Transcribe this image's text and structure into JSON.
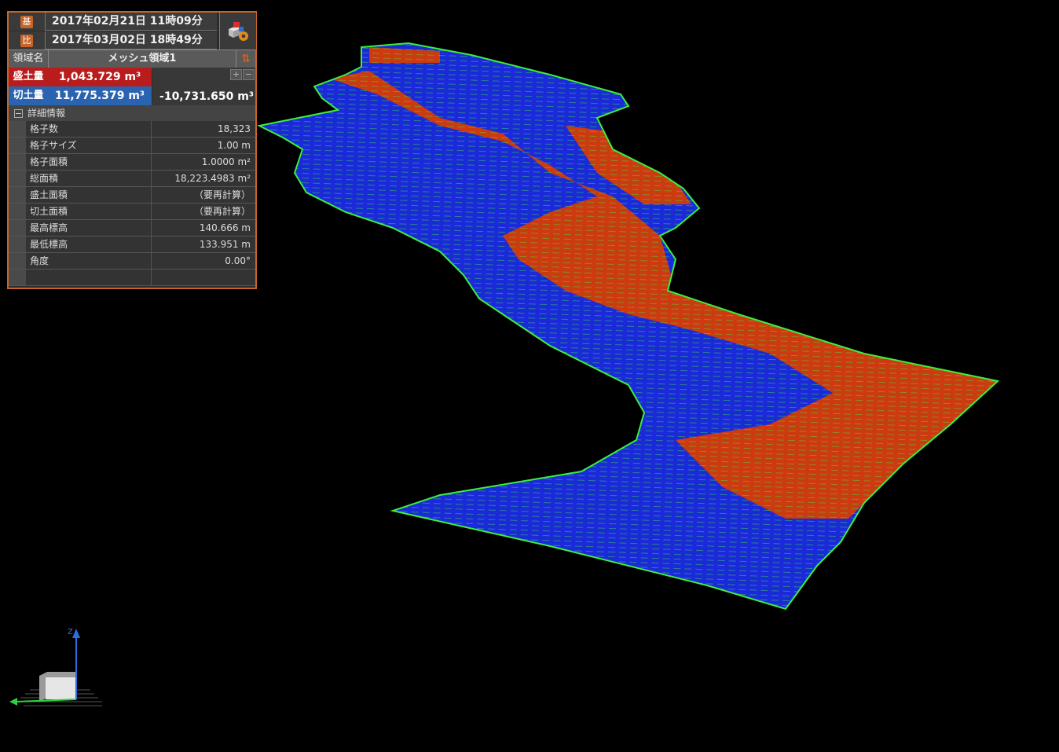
{
  "header": {
    "base_tag": "基",
    "base_date": "2017年02月21日 11時09分",
    "compare_tag": "比",
    "compare_date": "2017年03月02日 18時49分",
    "region_label": "領域名",
    "region_name": "メッシュ領域1",
    "sort_icon": "⇅"
  },
  "volumes": {
    "fill_label": "盛土量",
    "fill_value": "1,043.729 m³",
    "cut_label": "切土量",
    "cut_value": "11,775.379 m³",
    "net_value": "-10,731.650 m³",
    "plus": "+",
    "minus": "−"
  },
  "details": {
    "title": "詳細情報",
    "rows": [
      {
        "label": "格子数",
        "value": "18,323"
      },
      {
        "label": "格子サイズ",
        "value": "1.00 m"
      },
      {
        "label": "格子面積",
        "value": "1.0000 m²"
      },
      {
        "label": "総面積",
        "value": "18,223.4983 m²"
      },
      {
        "label": "盛土面積",
        "value": "（要再計算）"
      },
      {
        "label": "切土面積",
        "value": "（要再計算）"
      },
      {
        "label": "最高標高",
        "value": "140.666 m"
      },
      {
        "label": "最低標高",
        "value": "133.951 m"
      },
      {
        "label": "角度",
        "value": "0.00°"
      },
      {
        "label": "",
        "value": ""
      }
    ]
  },
  "axis": {
    "z_label": "Z"
  },
  "colors": {
    "accent": "#c8642a",
    "fill_red": "#b81c1c",
    "cut_blue": "#2a63b0",
    "mesh_blue": "#1a2ad8",
    "mesh_red": "#cc3a10",
    "mesh_edge": "#3cf03c"
  }
}
